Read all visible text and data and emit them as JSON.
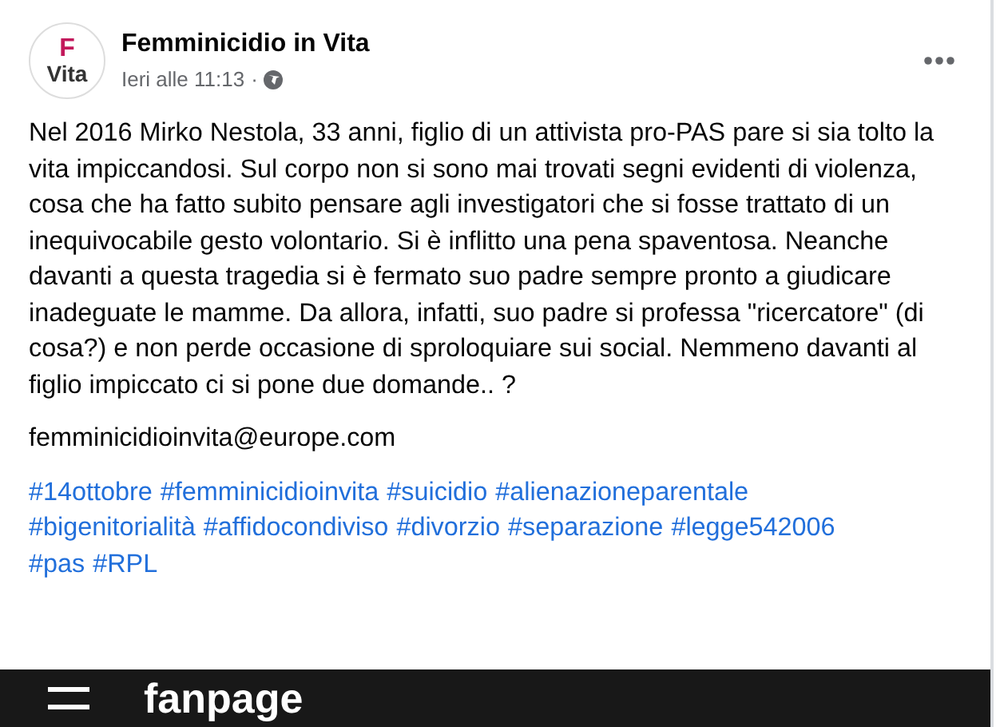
{
  "post": {
    "avatar": {
      "logo_letter": "F",
      "logo_word": "Vita"
    },
    "author": "Femminicidio in Vita",
    "time": "Ieri alle 11:13",
    "separator": "·",
    "body": "Nel 2016 Mirko Nestola, 33 anni, figlio di un attivista pro-PAS pare si sia tolto la vita impiccandosi. Sul corpo non si sono mai trovati segni evidenti di violenza, cosa che ha fatto subito pensare agli investigatori che si fosse trattato di un inequivocabile gesto volontario. Si è inflitto una pena spaventosa. Neanche davanti a questa tragedia si è fermato suo padre sempre pronto a giudicare inadeguate le mamme. Da allora, infatti, suo padre si professa \"ricercatore\" (di cosa?) e non perde occasione di sproloquiare sui social. Nemmeno davanti al figlio impiccato ci si pone due domande.. ?",
    "email": "femminicidioinvita@europe.com",
    "hashtags": [
      "#14ottobre",
      "#femminicidioinvita",
      "#suicidio",
      "#alienazioneparentale",
      "#bigenitorialità",
      "#affidocondiviso",
      "#divorzio",
      "#separazione",
      "#legge542006",
      "#pas",
      "#RPL"
    ],
    "link_preview": {
      "site": "fanpage"
    }
  }
}
